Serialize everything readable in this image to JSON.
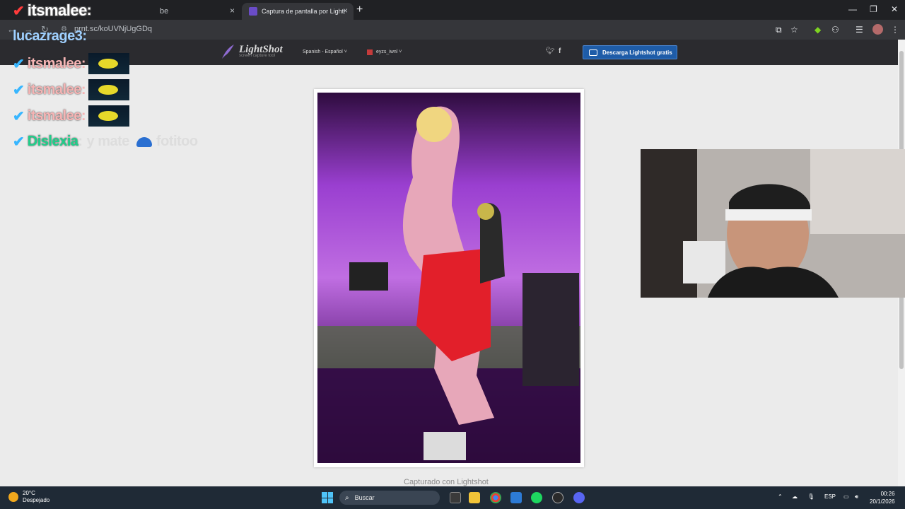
{
  "browser": {
    "tabs": [
      {
        "label": "be",
        "active": false
      },
      {
        "label": "Captura de pantalla por Lightsh",
        "active": true
      }
    ],
    "new_tab": "+",
    "close_glyph": "×",
    "url": "prnt.sc/koUVNjUgGDq"
  },
  "lightshot": {
    "logo_name": "LightShot",
    "logo_tagline": "screen capture tool",
    "language": "Spanish - Español",
    "user": "eyzs_iwnl",
    "download_button": "Descarga Lightshot gratis",
    "caption": "Capturado con Lightshot",
    "social_icons": [
      "twitter-icon",
      "facebook-icon"
    ]
  },
  "chat": {
    "messages": [
      {
        "user": "itsmalee",
        "suffix": ":",
        "message": "",
        "badge_color": "#ff3b3b",
        "name_color": "#ffffff",
        "emote": false
      },
      {
        "user": "lucazrage3",
        "suffix": ":",
        "message": "",
        "badge_color": "",
        "name_color": "#9fd0ff",
        "emote": false
      },
      {
        "user": "itsmalee",
        "suffix": ":",
        "message": "",
        "badge_color": "#38b6ff",
        "name_color": "#f5b4b4",
        "emote": true
      },
      {
        "user": "itsmalee",
        "suffix": ":",
        "message": "",
        "badge_color": "#38b6ff",
        "name_color": "#f5b4b4",
        "emote": true
      },
      {
        "user": "itsmalee",
        "suffix": ":",
        "message": "",
        "badge_color": "#38b6ff",
        "name_color": "#f5b4b4",
        "emote": true
      },
      {
        "user": "Dislexia",
        "suffix": ":",
        "message": "y mate",
        "message2": "fotitoo",
        "badge_color": "#38b6ff",
        "name_color": "#1fcf8a",
        "emote": false
      }
    ],
    "badge_glyph": "✔"
  },
  "taskbar": {
    "weather_temp": "20°C",
    "weather_desc": "Despejado",
    "search_label": "Buscar",
    "language": "ESP",
    "time": "00:26",
    "date": "20/1/2026"
  },
  "colors": {
    "accent_blue": "#1e5ca8",
    "chrome_dark": "#202124",
    "taskbar": "#1f2a36"
  }
}
